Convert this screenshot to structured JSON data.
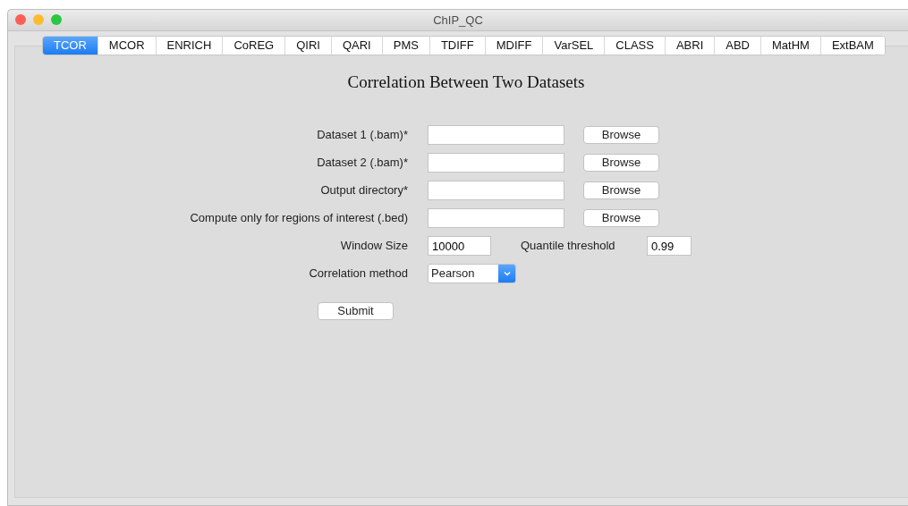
{
  "window": {
    "title": "ChIP_QC"
  },
  "tabs": [
    {
      "label": "TCOR",
      "selected": true
    },
    {
      "label": "MCOR",
      "selected": false
    },
    {
      "label": "ENRICH",
      "selected": false
    },
    {
      "label": "CoREG",
      "selected": false
    },
    {
      "label": "QIRI",
      "selected": false
    },
    {
      "label": "QARI",
      "selected": false
    },
    {
      "label": "PMS",
      "selected": false
    },
    {
      "label": "TDIFF",
      "selected": false
    },
    {
      "label": "MDIFF",
      "selected": false
    },
    {
      "label": "VarSEL",
      "selected": false
    },
    {
      "label": "CLASS",
      "selected": false
    },
    {
      "label": "ABRI",
      "selected": false
    },
    {
      "label": "ABD",
      "selected": false
    },
    {
      "label": "MatHM",
      "selected": false
    },
    {
      "label": "ExtBAM",
      "selected": false
    }
  ],
  "heading": "Correlation Between Two Datasets",
  "file_fields": [
    {
      "label": "Dataset 1 (.bam)*",
      "button": "Browse"
    },
    {
      "label": "Dataset 2 (.bam)*",
      "button": "Browse"
    },
    {
      "label": "Output directory*",
      "button": "Browse"
    },
    {
      "label": "Compute only for regions of interest (.bed)",
      "button": "Browse"
    }
  ],
  "params": [
    {
      "label": "Window Size",
      "value": "10000"
    },
    {
      "label": "Quantile threshold",
      "value": "0.99"
    }
  ],
  "method": {
    "label": "Correlation method",
    "value": "Pearson"
  },
  "submit": "Submit"
}
